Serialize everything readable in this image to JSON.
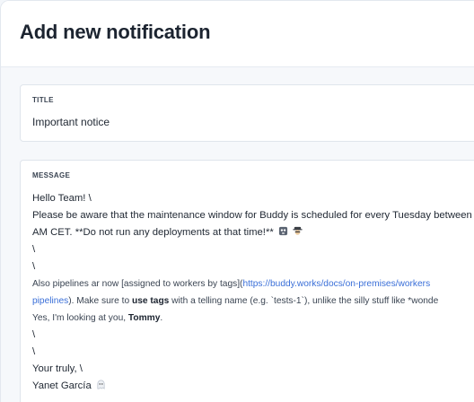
{
  "dialog": {
    "title": "Add new notification"
  },
  "title_field": {
    "label": "TITLE",
    "value": "Important notice"
  },
  "message_field": {
    "label": "MESSAGE",
    "lines": {
      "l1": "Hello Team! \\",
      "l2": "Please be aware that the maintenance window for Buddy is scheduled for every Tuesday between",
      "l3": "AM CET. **Do not run any deployments at that time!**",
      "l4": "\\",
      "l5": "\\",
      "l6_a": "Also pipelines ar now [assigned to workers by tags](",
      "l6_link": "https://buddy.works/docs/on-premises/workers",
      "l7_link": "pipelines",
      "l7_a": "). Make sure to ",
      "l7_bold": "use tags",
      "l7_b": " with a telling name (e.g. `tests-1`), unlike the silly stuff like *wonde",
      "l8_a": "Yes, I'm looking at you, ",
      "l8_bold": "Tommy",
      "l8_b": ".",
      "l9": "\\",
      "l10": "\\",
      "l11": "Your truly, \\",
      "l12": "Yanet García"
    },
    "emojis": [
      "skull-crossbones-icon",
      "detective-icon",
      "ghost-icon"
    ]
  }
}
